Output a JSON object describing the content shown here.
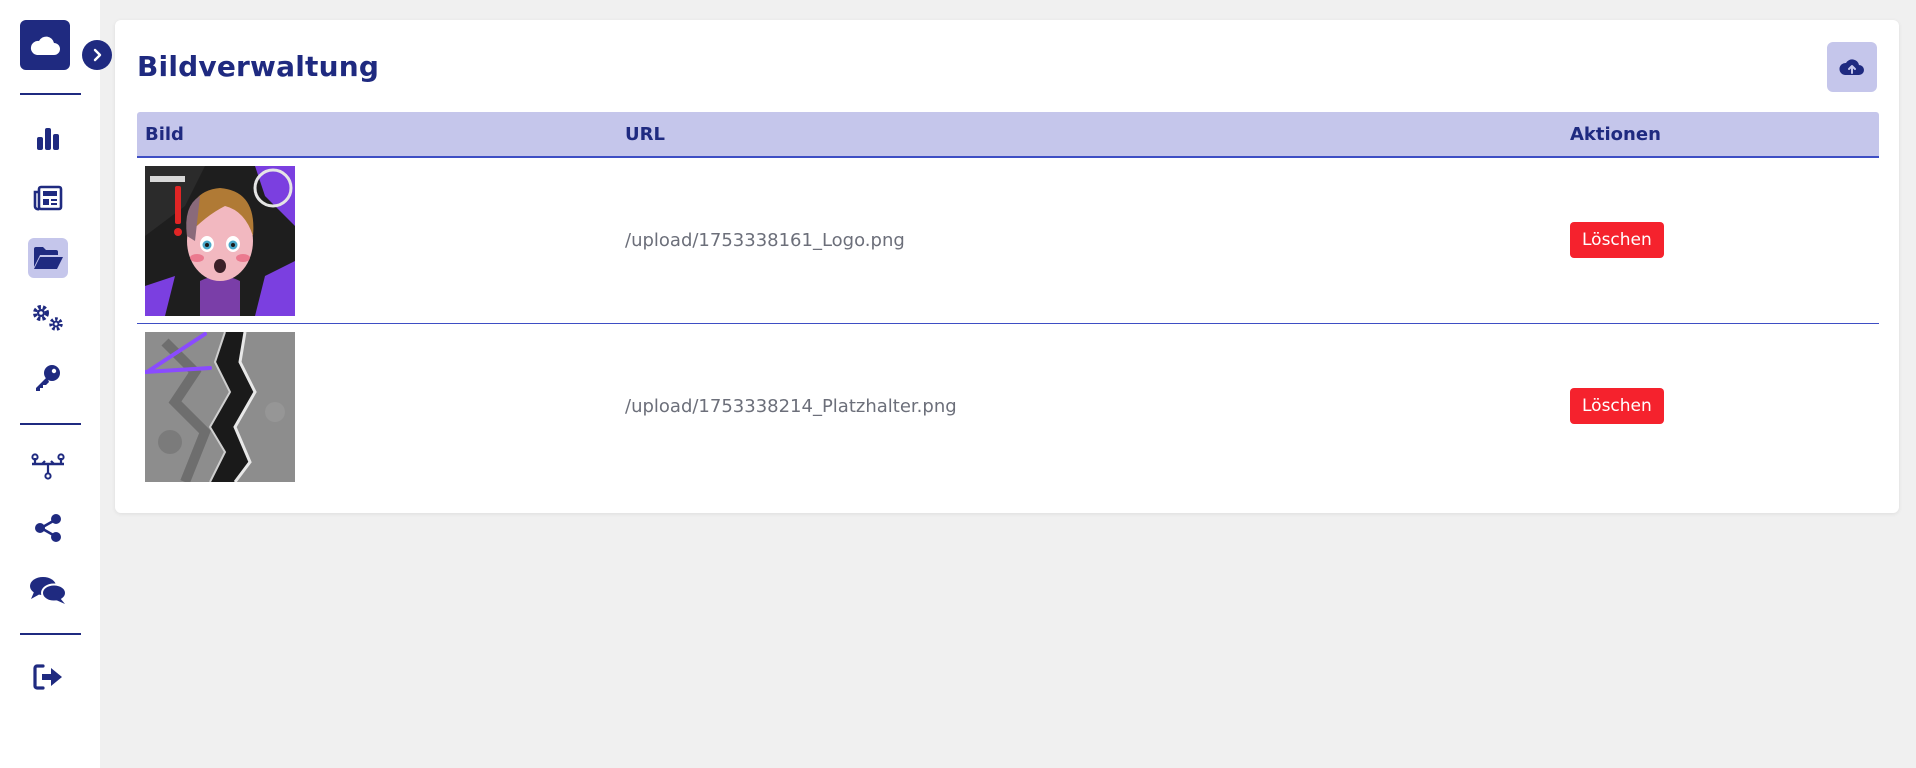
{
  "sidebar": {
    "logo_icon": "cloud-icon",
    "toggle_icon": "chevron-right-icon",
    "items": [
      {
        "id": "stats",
        "icon": "bar-chart-icon",
        "active": false
      },
      {
        "id": "news",
        "icon": "newspaper-icon",
        "active": false
      },
      {
        "id": "files",
        "icon": "folder-open-icon",
        "active": true
      },
      {
        "id": "settings",
        "icon": "gears-icon",
        "active": false
      },
      {
        "id": "keys",
        "icon": "key-icon",
        "active": false
      },
      {
        "id": "network",
        "icon": "network-icon",
        "active": false
      },
      {
        "id": "share",
        "icon": "share-icon",
        "active": false
      },
      {
        "id": "comments",
        "icon": "comments-icon",
        "active": false
      },
      {
        "id": "logout",
        "icon": "sign-out-icon",
        "active": false
      }
    ]
  },
  "page": {
    "title": "Bildverwaltung",
    "upload_icon": "cloud-upload-icon"
  },
  "table": {
    "columns": [
      "Bild",
      "URL",
      "Aktionen"
    ],
    "rows": [
      {
        "url": "/upload/1753338161_Logo.png",
        "action": "Löschen",
        "thumb_icon": "anime-avatar-image"
      },
      {
        "url": "/upload/1753338214_Platzhalter.png",
        "action": "Löschen",
        "thumb_icon": "torn-paper-image"
      }
    ]
  },
  "colors": {
    "primary": "#1f2a80",
    "accent_light": "#c5c6eb",
    "danger": "#f5222d",
    "background": "#f0f0f0"
  }
}
